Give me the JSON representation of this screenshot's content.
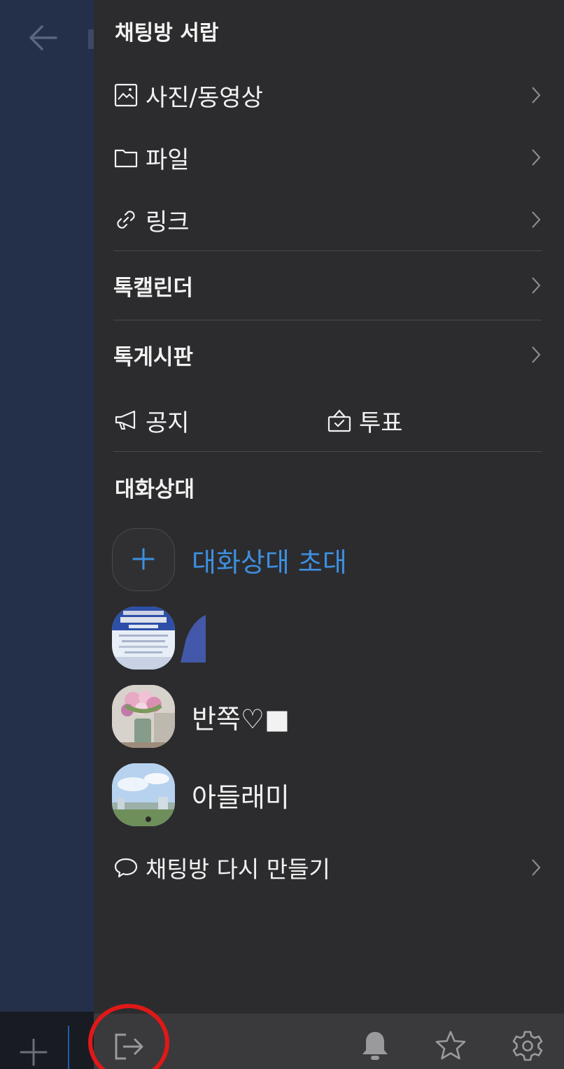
{
  "background": {
    "back_icon": "arrow-left-icon",
    "add_icon": "plus-icon"
  },
  "drawer": {
    "title": "채팅방 서랍",
    "media_items": [
      {
        "label": "사진/동영상",
        "icon": "image-icon"
      },
      {
        "label": "파일",
        "icon": "folder-icon"
      },
      {
        "label": "링크",
        "icon": "link-icon"
      }
    ],
    "calendar_label": "톡캘린더",
    "board_label": "톡게시판",
    "notice_label": "공지",
    "vote_label": "투표",
    "members_title": "대화상대",
    "invite_label": "대화상대 초대",
    "members": [
      {
        "name": "",
        "avatar": "poster-avatar"
      },
      {
        "name": "반쪽♡■",
        "avatar": "flowers-avatar"
      },
      {
        "name": "아들래미",
        "avatar": "sky-avatar"
      }
    ],
    "recreate_label": "채팅방 다시 만들기"
  },
  "bottom_bar": {
    "icons": [
      "exit-icon",
      "bell-icon",
      "star-icon",
      "gear-icon"
    ],
    "highlight_color": "#e01818"
  },
  "colors": {
    "accent": "#3d8fe0",
    "drawer_bg": "#2c2c2e",
    "chat_bg": "#243049"
  }
}
